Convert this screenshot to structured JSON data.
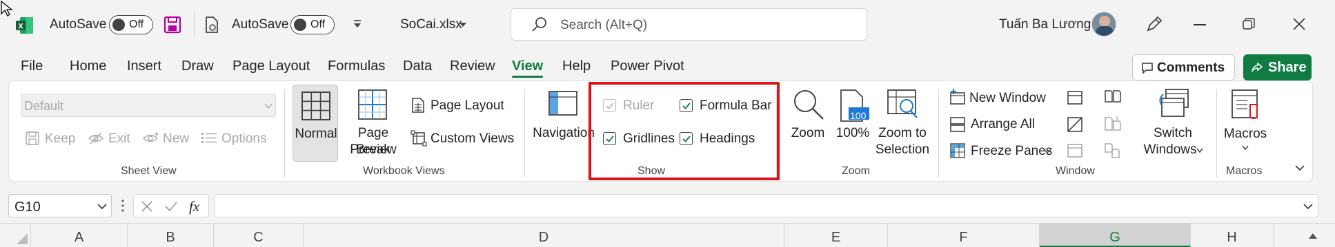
{
  "titlebar": {
    "autosave1_label": "AutoSave",
    "autosave1_state": "Off",
    "autosave2_label": "AutoSave",
    "autosave2_state": "Off",
    "filename": "SoCai.xlsx",
    "search_placeholder": "Search (Alt+Q)",
    "user_name": "Tuấn Ba Lương"
  },
  "menu": {
    "tabs": [
      "File",
      "Home",
      "Insert",
      "Draw",
      "Page Layout",
      "Formulas",
      "Data",
      "Review",
      "View",
      "Help",
      "Power Pivot"
    ],
    "active_tab": "View",
    "comments_label": "Comments",
    "share_label": "Share"
  },
  "ribbon": {
    "sheet_view": {
      "dropdown_value": "Default",
      "keep": "Keep",
      "exit": "Exit",
      "new": "New",
      "options": "Options",
      "group_label": "Sheet View"
    },
    "workbook_views": {
      "normal": "Normal",
      "page_break_1": "Page Break",
      "page_break_2": "Preview",
      "page_layout": "Page Layout",
      "custom_views": "Custom Views",
      "group_label": "Workbook Views"
    },
    "navigation": "Navigation",
    "show": {
      "ruler": "Ruler",
      "formula_bar": "Formula Bar",
      "gridlines": "Gridlines",
      "headings": "Headings",
      "group_label": "Show"
    },
    "zoom": {
      "zoom": "Zoom",
      "hundred": "100%",
      "hundred_badge": "100",
      "zoom_sel_1": "Zoom to",
      "zoom_sel_2": "Selection",
      "group_label": "Zoom"
    },
    "window": {
      "new_window": "New Window",
      "arrange_all": "Arrange All",
      "freeze_panes": "Freeze Panes",
      "switch_1": "Switch",
      "switch_2": "Windows",
      "group_label": "Window"
    },
    "macros": {
      "macros": "Macros",
      "group_label": "Macros"
    }
  },
  "formula_bar": {
    "name_box": "G10",
    "fx": "fx",
    "content": ""
  },
  "columns": [
    "A",
    "B",
    "C",
    "D",
    "E",
    "F",
    "G",
    "H"
  ],
  "colors": {
    "accent_green": "#107c41",
    "highlight_red": "#d9151b",
    "excel_green": "#185c37"
  }
}
